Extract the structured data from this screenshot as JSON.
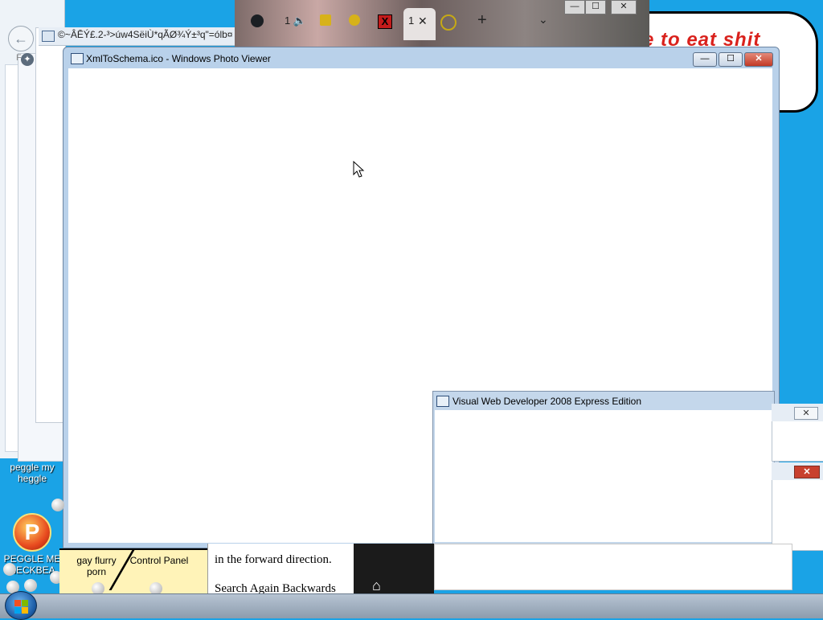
{
  "scribble": {
    "text": "e to eat shit"
  },
  "background_explorer": {
    "title": "©~ÂĒÝ£.2-³>úw4SëiÙ*qÃØ¾Ý±³q\"=ólb¤",
    "back_glyph": "←",
    "column_letter": "F"
  },
  "browser": {
    "tabs": [
      {
        "icon": "github-icon"
      },
      {
        "icon": "audio-icon",
        "label": "1 🔈"
      },
      {
        "icon": "yellow-favicon"
      },
      {
        "icon": "yellow-favicon"
      },
      {
        "icon": "x-favicon",
        "label": "X"
      },
      {
        "label": "1",
        "close": "✕",
        "active": true
      },
      {
        "icon": "yellow-circle-favicon"
      }
    ],
    "new_tab": "+",
    "tab_menu": "⌄",
    "controls": {
      "minimize": "—",
      "maximize": "☐",
      "close": "✕"
    }
  },
  "photo_viewer": {
    "title": "XmlToSchema.ico - Windows Photo Viewer",
    "controls": {
      "minimize": "—",
      "maximize": "☐",
      "close": "✕"
    }
  },
  "vwd": {
    "title": "Visual Web Developer 2008 Express Edition"
  },
  "right_dialogs": {
    "close1": "✕",
    "close2": "✕"
  },
  "desktop": {
    "icons": [
      {
        "label": "peggle my heggle"
      },
      {
        "label": "PEGGLE ME NECKBEA"
      },
      {
        "label": "gay flurry porn"
      },
      {
        "label": "Control Panel"
      }
    ],
    "peggle_letter": "P",
    "help_lines": [
      "in the forward direction.",
      "Search Again Backwards"
    ],
    "home_glyph": "⌂"
  },
  "colors": {
    "desktop": "#1aa3e6",
    "close_red": "#c23a26",
    "window_frame": "#b9d1ea"
  }
}
